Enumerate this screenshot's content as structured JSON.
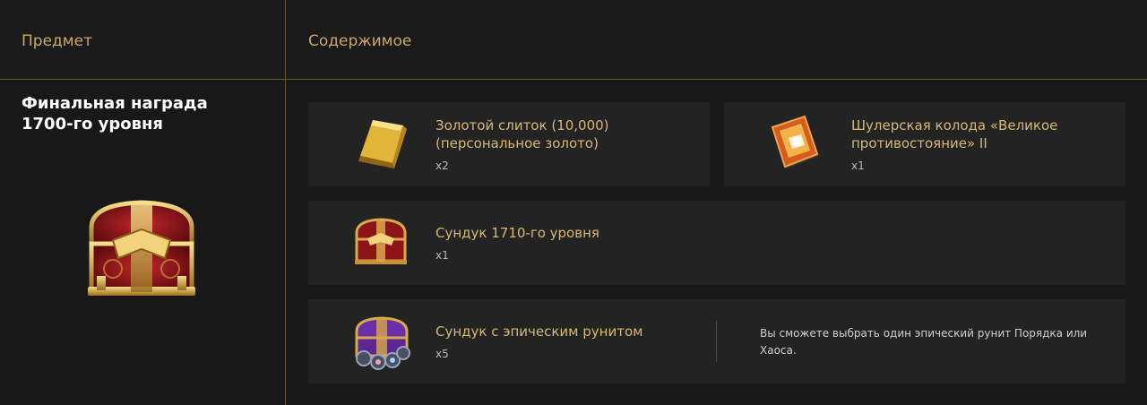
{
  "header": {
    "item_label": "Предмет",
    "contents_label": "Содержимое"
  },
  "item": {
    "title": "Финальная награда 1700-го уровня",
    "icon": "red-gold-chest-icon"
  },
  "contents": [
    {
      "name": "Золотой слиток (10,000) (персональное золото)",
      "qty": "x2",
      "icon": "gold-bar-icon"
    },
    {
      "name": "Шулерская колода «Великое противостояние» II",
      "qty": "x1",
      "icon": "card-deck-icon"
    },
    {
      "name": "Сундук 1710-го уровня",
      "qty": "x1",
      "icon": "red-chest-icon"
    },
    {
      "name": "Сундук с эпическим рунитом",
      "qty": "x5",
      "icon": "rune-chest-icon",
      "note": "Вы сможете выбрать один эпический рунит Порядка или Хаоса."
    }
  ],
  "colors": {
    "accent": "#d6b873",
    "divider": "#6d5a2c",
    "card_bg": "#232323",
    "page_bg": "#181818"
  }
}
